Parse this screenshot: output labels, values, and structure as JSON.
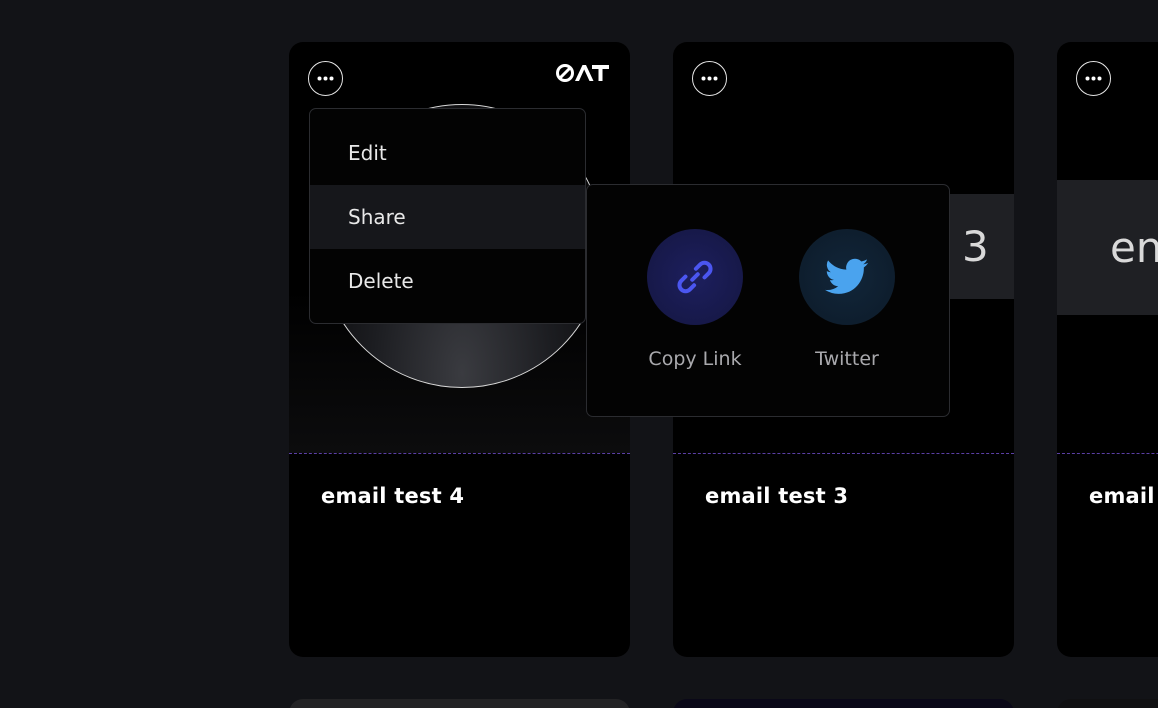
{
  "cards": [
    {
      "title": "email test 4",
      "logo_text": "ØAT"
    },
    {
      "title": "email test 3",
      "preview_text": "3"
    },
    {
      "title": "email",
      "preview_text": "en"
    }
  ],
  "menu": {
    "items": [
      {
        "label": "Edit"
      },
      {
        "label": "Share"
      },
      {
        "label": "Delete"
      }
    ],
    "active_item": "Share"
  },
  "share": {
    "options": [
      {
        "label": "Copy Link",
        "icon": "link-icon"
      },
      {
        "label": "Twitter",
        "icon": "twitter-icon"
      }
    ]
  },
  "colors": {
    "background": "#121317",
    "card": "#000000",
    "copy_link_icon": "#4b56f0",
    "twitter_icon": "#4aa3ee",
    "divider": "#5b3fa6"
  }
}
